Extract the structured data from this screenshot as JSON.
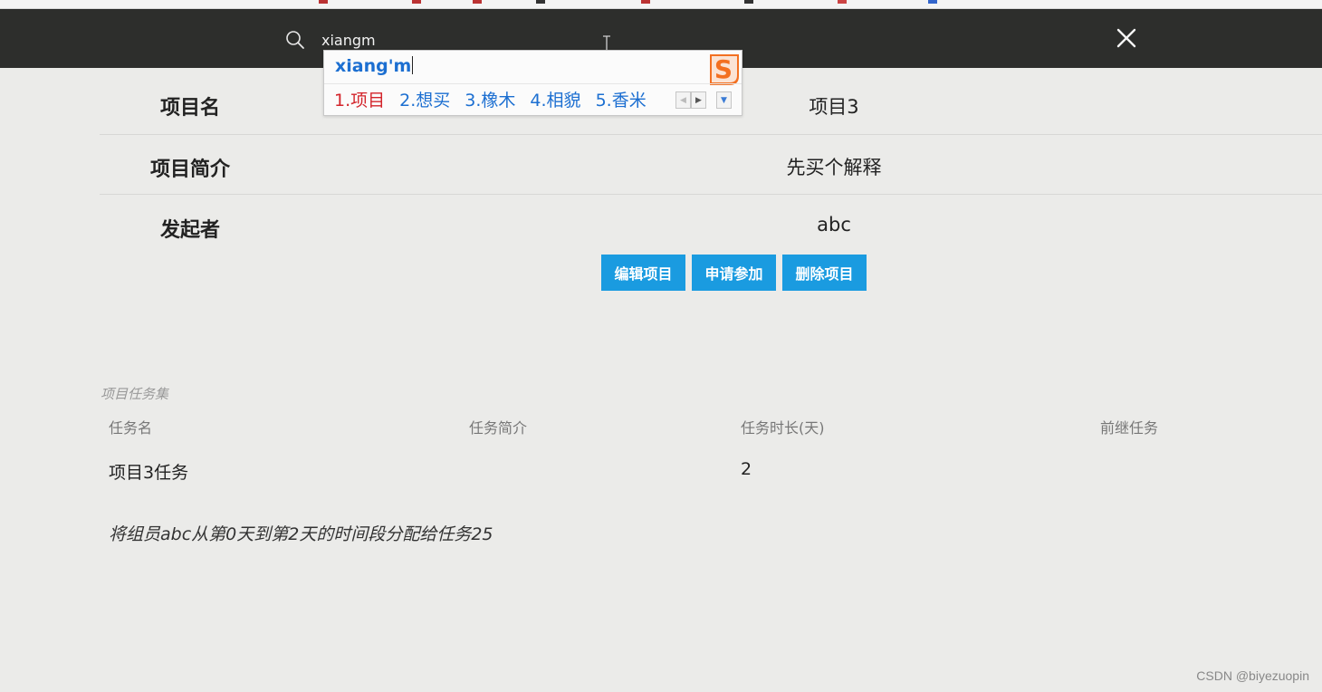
{
  "search": {
    "value": "xiangm",
    "icon": "search-icon",
    "close_icon": "close-icon"
  },
  "ime": {
    "composition": "xiang'm",
    "candidates": [
      "1.项目",
      "2.想买",
      "3.橡木",
      "4.相貌",
      "5.香米"
    ],
    "logo": "sogou-ime-logo"
  },
  "project": {
    "rows": [
      {
        "label": "项目名",
        "value": "项目3"
      },
      {
        "label": "项目简介",
        "value": "先买个解释"
      },
      {
        "label": "发起者",
        "value": "abc"
      }
    ],
    "buttons": {
      "edit": "编辑项目",
      "join": "申请参加",
      "delete": "删除项目"
    }
  },
  "tasks": {
    "caption": "项目任务集",
    "headers": [
      "任务名",
      "任务简介",
      "任务时长(天)",
      "前继任务"
    ],
    "rows": [
      {
        "name": "项目3任务",
        "intro": "",
        "duration": "2",
        "predecessor": ""
      }
    ],
    "assignment": "将组员abc从第0天到第2天的时间段分配给任务25"
  },
  "watermark": "CSDN @biyezuopin",
  "colors": {
    "searchbar_bg": "#2d2e2c",
    "button_bg": "#1a9be0",
    "page_bg": "#ebebe9",
    "ime_highlight": "#d3242b",
    "ime_candidate": "#1c6fd1"
  }
}
